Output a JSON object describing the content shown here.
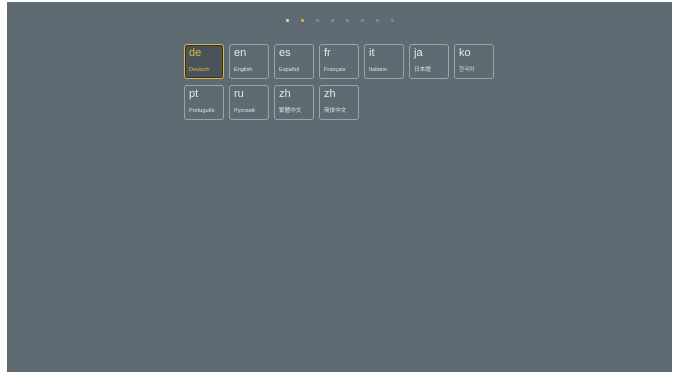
{
  "theme": {
    "background": "#5f6b73",
    "tile_border": "#9aa3a9",
    "accent": "#e3b43a",
    "text": "#e6e9eb"
  },
  "pager": {
    "dots": [
      {
        "color": "#d7dbde",
        "active": false
      },
      {
        "color": "#e3b43a",
        "active": true
      },
      {
        "color": "#7f8a91",
        "active": false
      },
      {
        "color": "#7f8a91",
        "active": false
      },
      {
        "color": "#7f8a91",
        "active": false
      },
      {
        "color": "#7f8a91",
        "active": false
      },
      {
        "color": "#7f8a91",
        "active": false
      },
      {
        "color": "#7f8a91",
        "active": false
      }
    ]
  },
  "languages": [
    {
      "code": "de",
      "name": "Deutsch",
      "selected": true
    },
    {
      "code": "en",
      "name": "English",
      "selected": false
    },
    {
      "code": "es",
      "name": "Español",
      "selected": false
    },
    {
      "code": "fr",
      "name": "Français",
      "selected": false
    },
    {
      "code": "it",
      "name": "Italiano",
      "selected": false
    },
    {
      "code": "ja",
      "name": "日本語",
      "selected": false
    },
    {
      "code": "ko",
      "name": "한국어",
      "selected": false
    },
    {
      "code": "pt",
      "name": "Português",
      "selected": false
    },
    {
      "code": "ru",
      "name": "Русский",
      "selected": false
    },
    {
      "code": "zh",
      "name": "繁體中文",
      "selected": false
    },
    {
      "code": "zh",
      "name": "简体中文",
      "selected": false
    }
  ]
}
